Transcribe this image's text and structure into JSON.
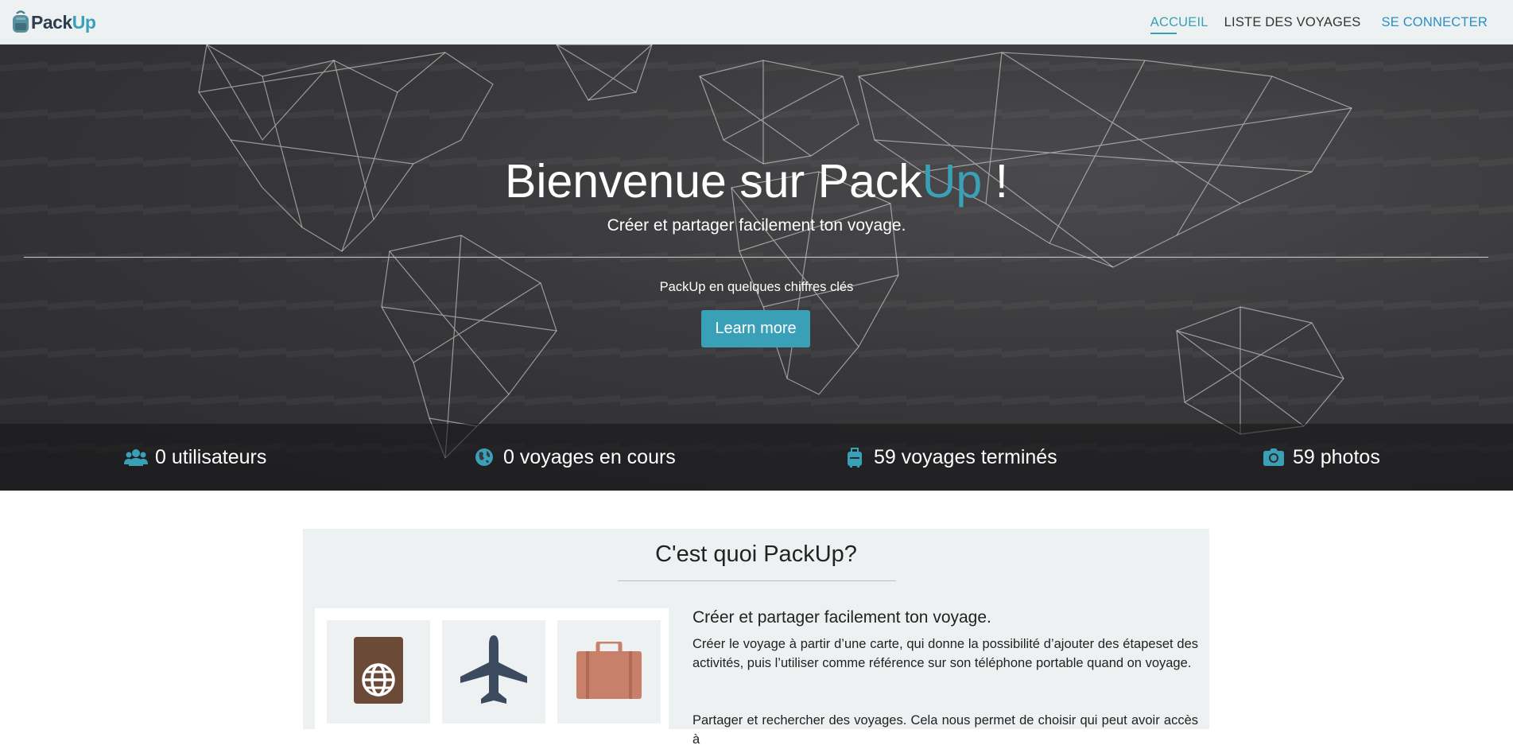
{
  "brand": {
    "name_main": "Pack",
    "name_accent": "Up",
    "accent_color": "#3aa0b8"
  },
  "nav": {
    "home": "ACCUEIL",
    "trips": "LISTE DES VOYAGES",
    "login": "SE CONNECTER"
  },
  "hero": {
    "title_prefix": "Bienvenue sur Pack",
    "title_accent": "Up",
    "title_suffix": " !",
    "subtitle": "Créer et partager facilement ton voyage.",
    "key_figures": "PackUp en quelques chiffres clés",
    "button": "Learn more"
  },
  "stats": [
    {
      "icon": "users-icon",
      "label": "0 utilisateurs"
    },
    {
      "icon": "globe-icon",
      "label": "0 voyages en cours"
    },
    {
      "icon": "luggage-icon",
      "label": "59 voyages terminés"
    },
    {
      "icon": "camera-icon",
      "label": "59 photos"
    }
  ],
  "about": {
    "title": "C'est quoi PackUp?",
    "heading": "Créer et partager facilement ton voyage.",
    "paragraph1": "Créer le voyage à partir d’une carte, qui donne la possibilité d’ajouter des étapeset des activités, puis l’utiliser comme référence sur son téléphone portable quand on voyage.",
    "paragraph2": "Partager et rechercher des voyages. Cela nous permet de choisir qui peut avoir accès à",
    "icons": [
      "passport-icon",
      "airplane-icon",
      "suitcase-icon"
    ]
  }
}
